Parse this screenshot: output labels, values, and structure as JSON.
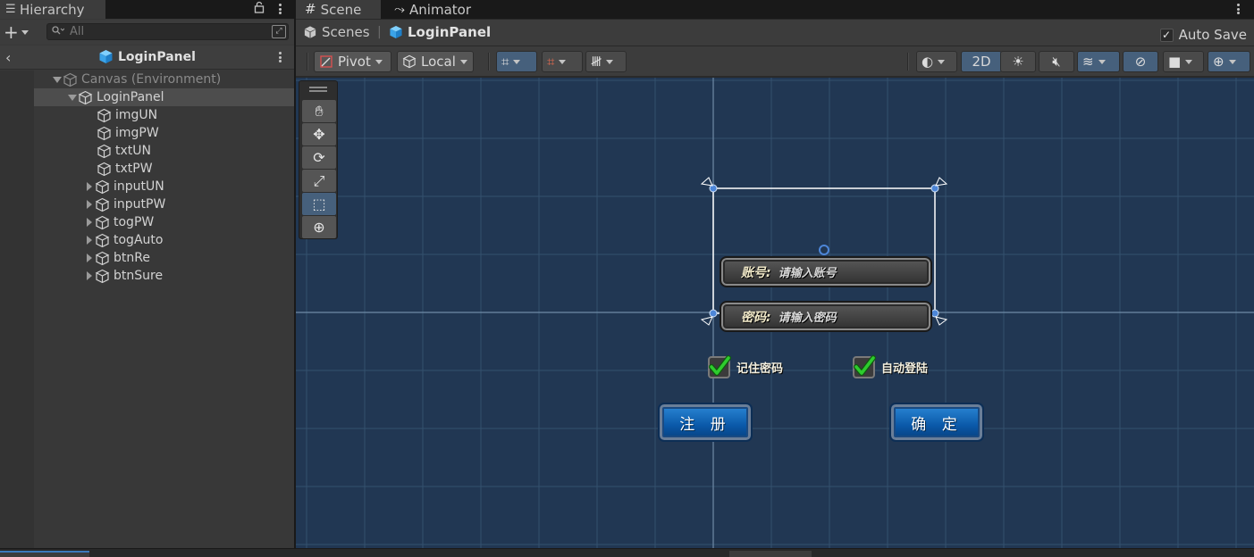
{
  "hierarchy": {
    "tab_label": "Hierarchy",
    "search_placeholder": "All",
    "header_title": "LoginPanel",
    "tree": [
      {
        "label": "Canvas (Environment)",
        "expanded": true,
        "dim": true
      },
      {
        "label": "LoginPanel",
        "expanded": true,
        "selected": true
      },
      {
        "label": "imgUN"
      },
      {
        "label": "imgPW"
      },
      {
        "label": "txtUN"
      },
      {
        "label": "txtPW"
      },
      {
        "label": "inputUN",
        "collapsed": true
      },
      {
        "label": "inputPW",
        "collapsed": true
      },
      {
        "label": "togPW",
        "collapsed": true
      },
      {
        "label": "togAuto",
        "collapsed": true
      },
      {
        "label": "btnRe",
        "collapsed": true
      },
      {
        "label": "btnSure",
        "collapsed": true
      }
    ]
  },
  "scene": {
    "tabs": [
      {
        "label": "Scene"
      },
      {
        "label": "Animator"
      }
    ],
    "breadcrumb": {
      "scenes": "Scenes",
      "current": "LoginPanel"
    },
    "auto_save": {
      "label": "Auto Save",
      "checked": true
    },
    "toolbar": {
      "pivot": "Pivot",
      "local": "Local",
      "mode_2d": "2D"
    },
    "canvas": {
      "username_label": "账号:",
      "username_placeholder": "请输入账号",
      "password_label": "密码:",
      "password_placeholder": "请输入密码",
      "remember_label": "记住密码",
      "auto_login_label": "自动登陆",
      "register_button": "注 册",
      "confirm_button": "确 定"
    }
  },
  "colors": {
    "viewport_bg": "#213753",
    "active_tool": "#46607c",
    "button_blue": "#0a58a8",
    "check_green": "#2ecc2e"
  }
}
